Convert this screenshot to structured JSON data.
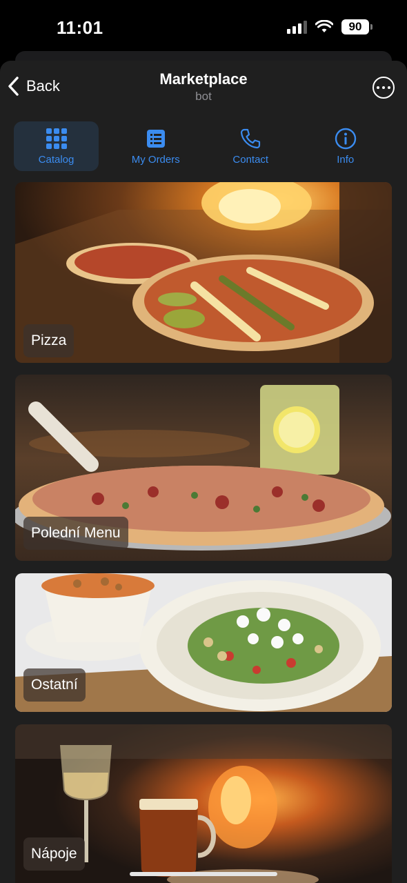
{
  "status": {
    "time": "11:01",
    "battery": "90"
  },
  "nav": {
    "back_label": "Back",
    "title": "Marketplace",
    "subtitle": "bot"
  },
  "tabs": [
    {
      "label": "Catalog",
      "icon": "grid-icon",
      "active": true
    },
    {
      "label": "My Orders",
      "icon": "list-icon",
      "active": false
    },
    {
      "label": "Contact",
      "icon": "phone-icon",
      "active": false
    },
    {
      "label": "Info",
      "icon": "info-icon",
      "active": false
    }
  ],
  "categories": [
    {
      "label": "Pizza"
    },
    {
      "label": "Polední Menu"
    },
    {
      "label": "Ostatní"
    },
    {
      "label": "Nápoje"
    }
  ],
  "colors": {
    "accent": "#3b8cf0",
    "panel_bg": "#1f1f1f"
  }
}
